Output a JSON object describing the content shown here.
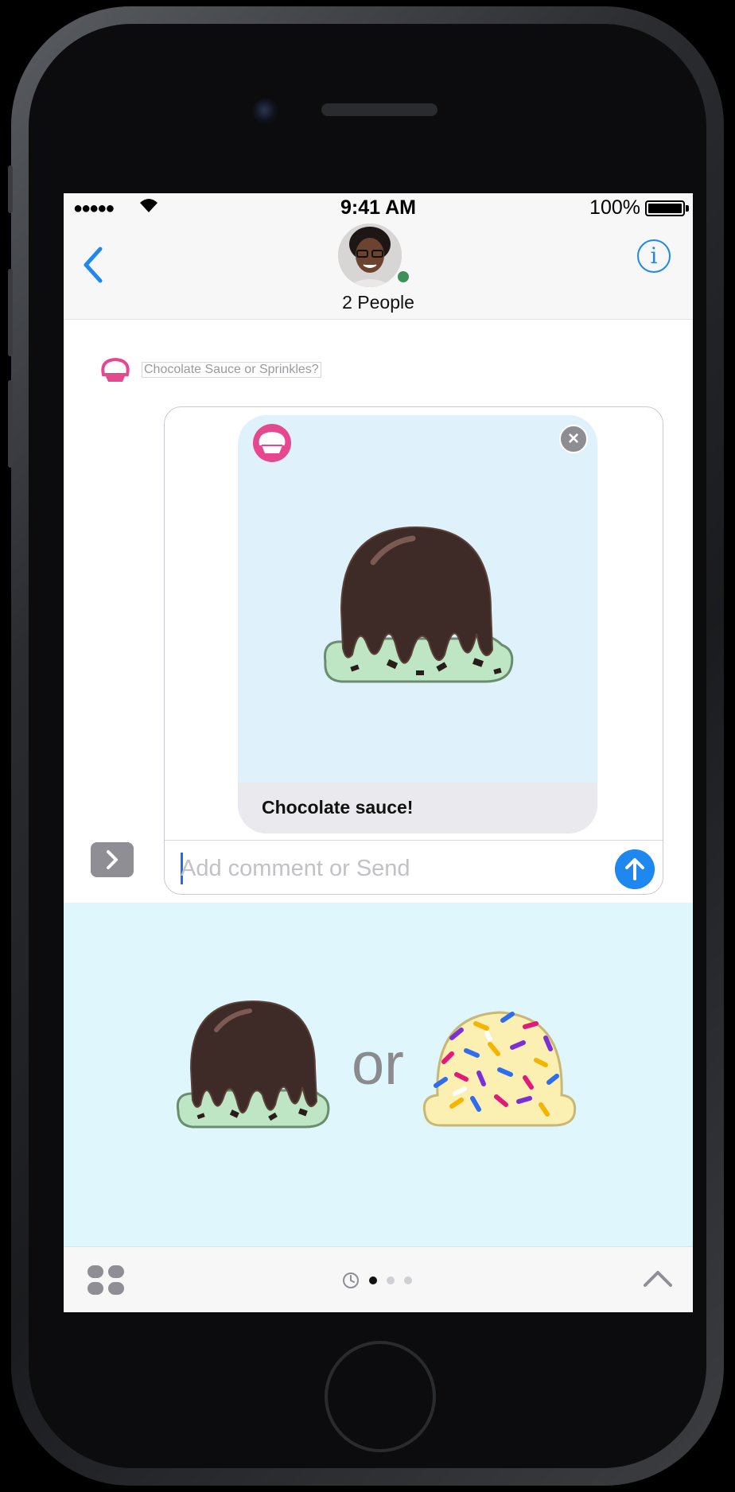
{
  "status_bar": {
    "signal": "●●●●●",
    "time": "9:41 AM",
    "battery_percent": "100%",
    "battery_level": 1.0
  },
  "header": {
    "back_icon": "chevron-left-icon",
    "title": "2 People",
    "info_icon": "info-icon",
    "info_glyph": "i"
  },
  "conversation": {
    "caption": "Chocolate Sauce or Sprinkles?",
    "caption_icon": "ice-cream-app-icon"
  },
  "message_card": {
    "app_icon": "ice-cream-app-icon",
    "dismiss_glyph": "×",
    "art": "chocolate-sauce-ice-cream",
    "caption": "Chocolate sauce!"
  },
  "composer": {
    "placeholder": "Add comment or Send",
    "value": "",
    "send_icon": "arrow-up-icon",
    "expand_icon": "chevron-right-icon"
  },
  "app_drawer": {
    "choice_a": "chocolate-sauce-ice-cream",
    "separator": "or",
    "choice_b": "sprinkles-ice-cream"
  },
  "tray": {
    "apps_icon": "app-drawer-icon",
    "recents_icon": "clock-icon",
    "page_count": 3,
    "active_page": 0,
    "collapse_icon": "chevron-up-icon"
  },
  "colors": {
    "accent": "#1e88f0",
    "card_bg": "#dff1fa",
    "drawer_bg": "#dff7fc",
    "brand_pink": "#e5488f",
    "mint": "#bfe6c4",
    "chocolate": "#3e2a26"
  }
}
